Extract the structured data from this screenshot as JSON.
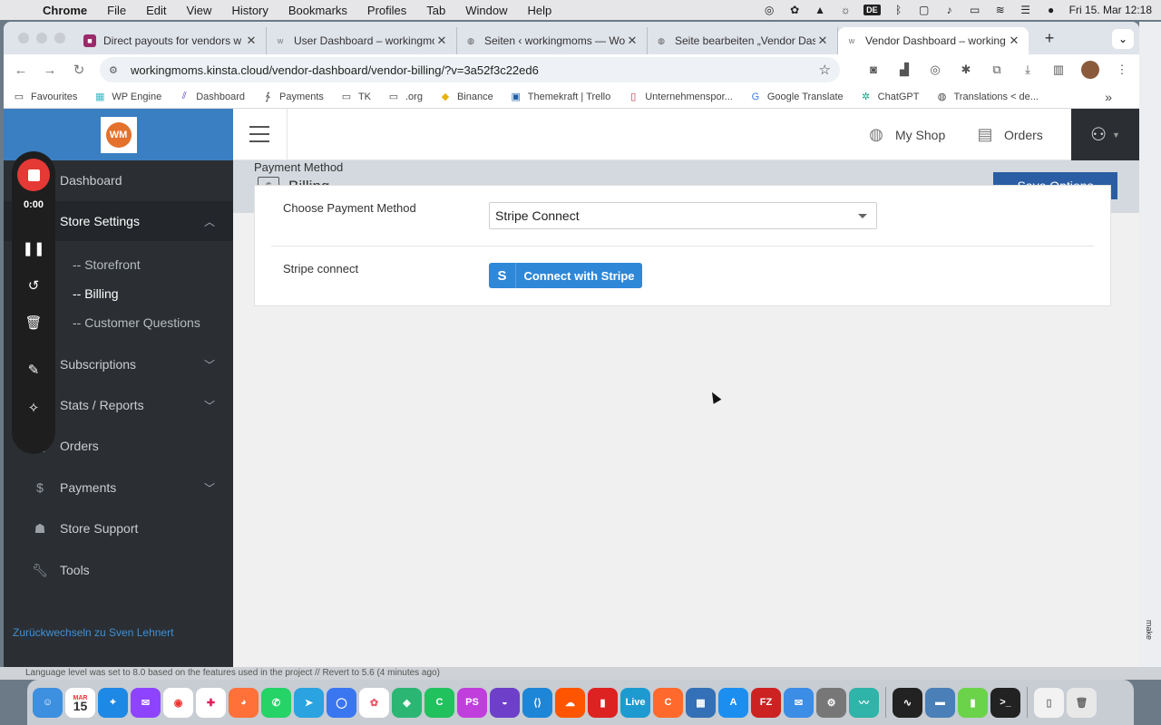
{
  "menubar": {
    "app": "Chrome",
    "items": [
      "File",
      "Edit",
      "View",
      "History",
      "Bookmarks",
      "Profiles",
      "Tab",
      "Window",
      "Help"
    ],
    "keyboard": "DE",
    "datetime": "Fri 15. Mar  12:18"
  },
  "tabs": [
    {
      "title": "Direct payouts for vendors w",
      "color": "#9b2a6a"
    },
    {
      "title": "User Dashboard – workingmo",
      "color": "#7b7b7b"
    },
    {
      "title": "Seiten ‹ workingmoms — Wo",
      "color": "#555555"
    },
    {
      "title": "Seite bearbeiten „Vendor Das",
      "color": "#555555"
    },
    {
      "title": "Vendor Dashboard – working",
      "color": "#7b7b7b"
    }
  ],
  "address_bar": {
    "url": "workingmoms.kinsta.cloud/vendor-dashboard/vendor-billing/?v=3a52f3c22ed6"
  },
  "bookmarks": [
    "Favourites",
    "WP Engine",
    "Dashboard",
    "Payments",
    "TK",
    ".org",
    "Binance",
    "Themekraft | Trello",
    "Unternehmenspor...",
    "Google Translate",
    "ChatGPT",
    "Translations < de..."
  ],
  "sidebar": {
    "logo_text": "WM",
    "items": [
      {
        "label": "Dashboard"
      },
      {
        "label": "Store Settings"
      },
      {
        "label": "Subscriptions"
      },
      {
        "label": "Stats / Reports"
      },
      {
        "label": "Orders"
      },
      {
        "label": "Payments"
      },
      {
        "label": "Store Support"
      },
      {
        "label": "Tools"
      }
    ],
    "subitems": [
      "-- Storefront",
      "-- Billing",
      "-- Customer Questions"
    ],
    "switch_back": "Zurückwechseln zu Sven Lehnert"
  },
  "recorder": {
    "time": "0:00"
  },
  "topbar": {
    "my_shop": "My Shop",
    "orders": "Orders"
  },
  "page": {
    "title": "Billing",
    "save_button": "Save Options",
    "section_label": "Payment Method",
    "choose_label": "Choose Payment Method",
    "selected_method": "Stripe Connect",
    "stripe_label": "Stripe connect",
    "stripe_button": "Connect with Stripe"
  },
  "background": {
    "ide_status": "Language level was set to 8.0 based on the features used in the project // Revert to 5.6 (4 minutes ago)",
    "side_text": "make"
  },
  "dock": {
    "calendar_month": "MAR",
    "calendar_day": "15",
    "live_label": "Live"
  }
}
